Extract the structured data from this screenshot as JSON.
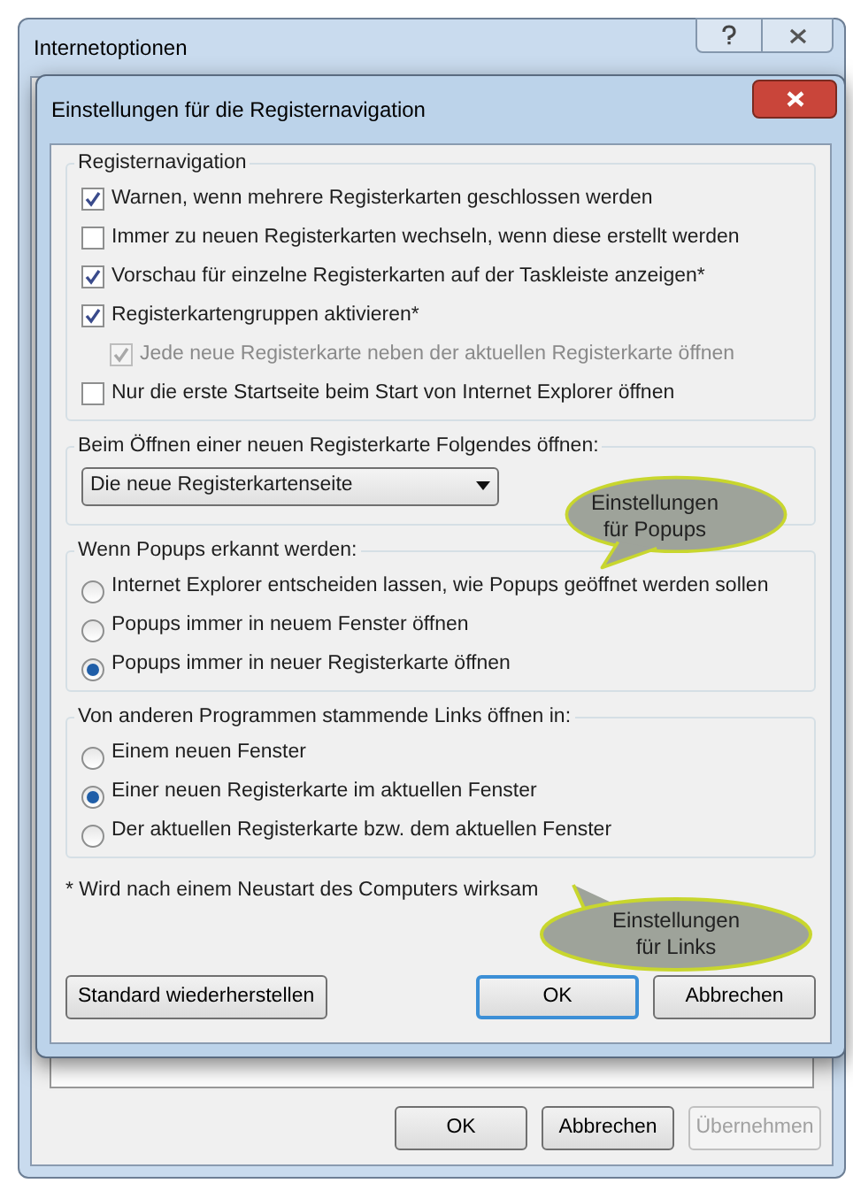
{
  "outer_window": {
    "title": "Internetoptionen",
    "buttons": [
      {
        "label": "OK",
        "disabled": false
      },
      {
        "label": "Abbrechen",
        "disabled": false
      },
      {
        "label": "Übernehmen",
        "disabled": true
      }
    ]
  },
  "dialog": {
    "title": "Einstellungen für die Registernavigation",
    "groups": [
      {
        "kind": "checkboxes",
        "title": "Registernavigation",
        "items": [
          {
            "label": "Warnen, wenn mehrere Registerkarten geschlossen werden",
            "checked": true,
            "disabled": false
          },
          {
            "label": "Immer zu neuen Registerkarten wechseln, wenn diese erstellt werden",
            "checked": false,
            "disabled": false
          },
          {
            "label": "Vorschau für einzelne Registerkarten auf der Taskleiste anzeigen*",
            "checked": true,
            "disabled": false
          },
          {
            "label": "Registerkartengruppen aktivieren*",
            "checked": true,
            "disabled": false,
            "children": [
              {
                "label": "Jede neue Registerkarte neben der aktuellen Registerkarte öffnen",
                "checked": true,
                "disabled": true
              }
            ]
          },
          {
            "label": "Nur die erste Startseite beim Start von Internet Explorer öffnen",
            "checked": false,
            "disabled": false
          }
        ]
      },
      {
        "kind": "dropdown",
        "title": "Beim Öffnen einer neuen Registerkarte Folgendes öffnen:",
        "value": "Die neue Registerkartenseite"
      },
      {
        "kind": "radios",
        "title": "Wenn Popups erkannt werden:",
        "items": [
          {
            "label": "Internet Explorer entscheiden lassen, wie Popups geöffnet werden sollen",
            "selected": false
          },
          {
            "label": "Popups immer in neuem Fenster öffnen",
            "selected": false
          },
          {
            "label": "Popups immer in neuer Registerkarte öffnen",
            "selected": true
          }
        ]
      },
      {
        "kind": "radios",
        "title": "Von anderen Programmen stammende Links öffnen in:",
        "items": [
          {
            "label": "Einem neuen Fenster",
            "selected": false
          },
          {
            "label": "Einer neuen Registerkarte im aktuellen Fenster",
            "selected": true
          },
          {
            "label": "Der aktuellen Registerkarte bzw. dem aktuellen Fenster",
            "selected": false
          }
        ]
      }
    ],
    "footnote": "* Wird nach einem Neustart des Computers wirksam",
    "buttons": [
      {
        "label": "Standard wiederherstellen",
        "default": false
      },
      {
        "label": "OK",
        "default": true
      },
      {
        "label": "Abbrechen",
        "default": false
      }
    ]
  },
  "callouts": [
    {
      "kind": "popups",
      "text": "Einstellungen für Popups"
    },
    {
      "kind": "links",
      "text": "Einstellungen für Links"
    }
  ]
}
